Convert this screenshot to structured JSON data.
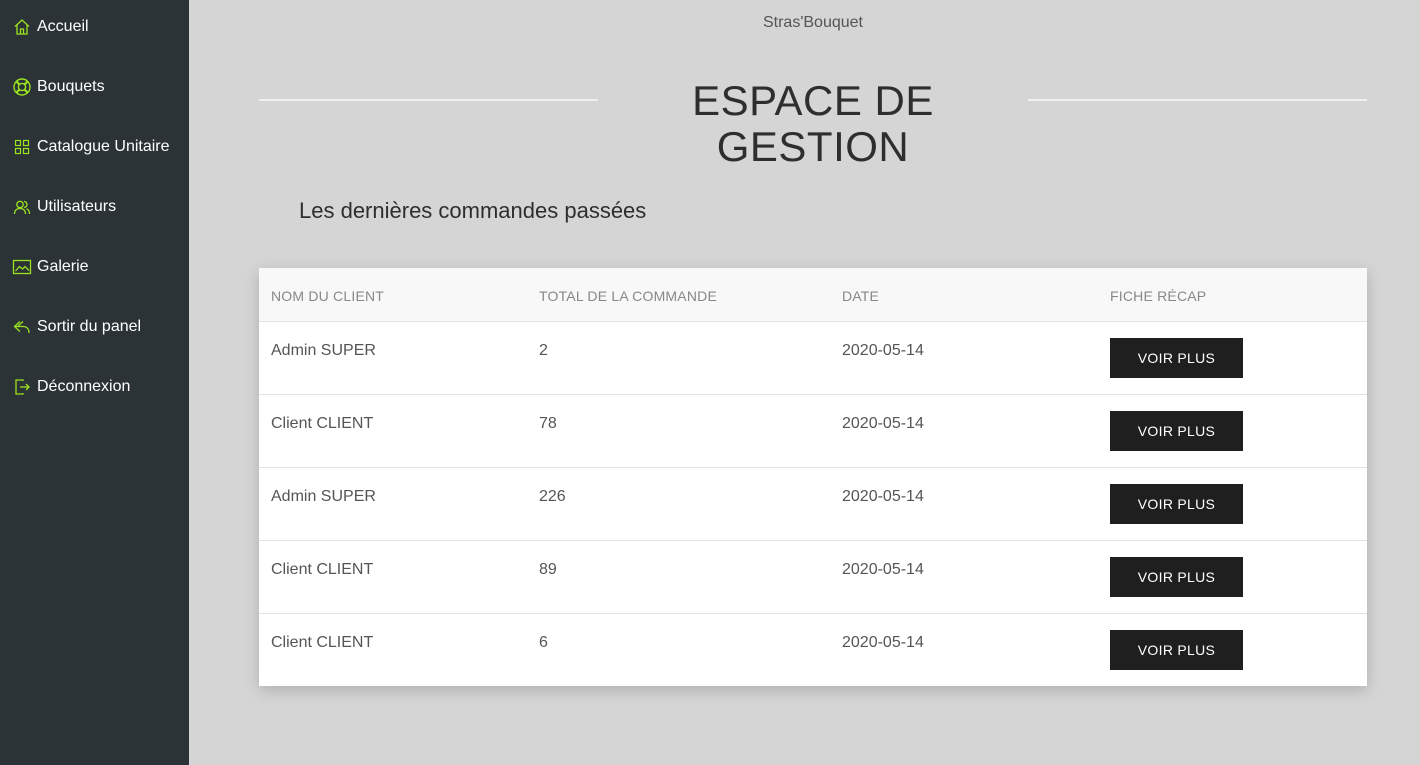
{
  "colors": {
    "sidebar_bg": "#2b3336",
    "icon_accent": "#9be31f",
    "page_bg": "#d5d5d5",
    "button_bg": "#1f1f1f"
  },
  "sidebar": {
    "items": [
      {
        "label": "Accueil",
        "icon": "home-icon"
      },
      {
        "label": "Bouquets",
        "icon": "lifebuoy-icon"
      },
      {
        "label": "Catalogue Unitaire",
        "icon": "grid-icon"
      },
      {
        "label": "Utilisateurs",
        "icon": "users-icon"
      },
      {
        "label": "Galerie",
        "icon": "image-icon"
      },
      {
        "label": "Sortir du panel",
        "icon": "reply-icon"
      },
      {
        "label": "Déconnexion",
        "icon": "logout-icon"
      }
    ]
  },
  "header": {
    "brand": "Stras'Bouquet",
    "title": "ESPACE DE GESTION"
  },
  "orders": {
    "heading": "Les dernières commandes passées",
    "columns": [
      "NOM DU CLIENT",
      "TOTAL DE LA COMMANDE",
      "DATE",
      "FICHE RÉCAP"
    ],
    "rows": [
      {
        "client": "Admin SUPER",
        "total": "2",
        "date": "2020-05-14",
        "action": "VOIR PLUS"
      },
      {
        "client": "Client CLIENT",
        "total": "78",
        "date": "2020-05-14",
        "action": "VOIR PLUS"
      },
      {
        "client": "Admin SUPER",
        "total": "226",
        "date": "2020-05-14",
        "action": "VOIR PLUS"
      },
      {
        "client": "Client CLIENT",
        "total": "89",
        "date": "2020-05-14",
        "action": "VOIR PLUS"
      },
      {
        "client": "Client CLIENT",
        "total": "6",
        "date": "2020-05-14",
        "action": "VOIR PLUS"
      }
    ]
  }
}
